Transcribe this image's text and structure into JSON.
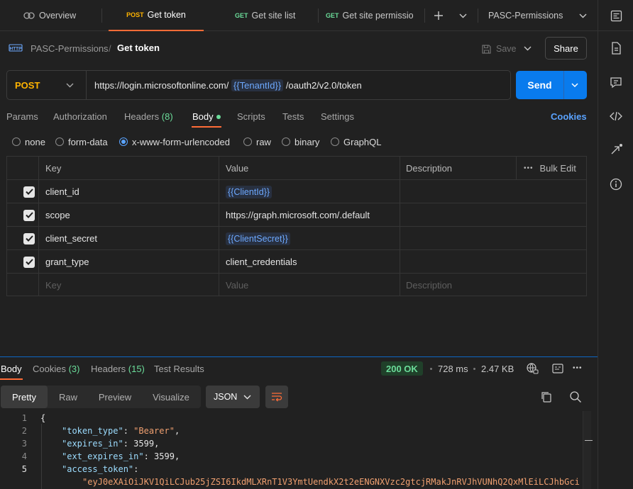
{
  "tabs": [
    {
      "method": "",
      "label": "Overview",
      "active": false
    },
    {
      "method": "POST",
      "label": "Get token",
      "active": true
    },
    {
      "method": "GET",
      "label": "Get site list",
      "active": false
    },
    {
      "method": "GET",
      "label": "Get site permission",
      "active": false
    }
  ],
  "workspace": {
    "env_label": "PASC-Permissions"
  },
  "breadcrumb": {
    "collection": "PASC-Permissions",
    "separator": "/",
    "request": "Get token"
  },
  "toolbar": {
    "save_label": "Save",
    "share_label": "Share"
  },
  "request": {
    "method": "POST",
    "url_prefix": "https://login.microsoftonline.com/",
    "url_var": "{{TenantId}}",
    "url_suffix": "/oauth2/v2.0/token",
    "send_label": "Send"
  },
  "request_tabs": {
    "params": "Params",
    "authorization": "Authorization",
    "headers": "Headers",
    "headers_count": "(8)",
    "body": "Body",
    "scripts": "Scripts",
    "tests": "Tests",
    "settings": "Settings",
    "cookies": "Cookies"
  },
  "body_types": [
    "none",
    "form-data",
    "x-www-form-urlencoded",
    "raw",
    "binary",
    "GraphQL"
  ],
  "body_type_selected": "x-www-form-urlencoded",
  "params_table": {
    "headers": {
      "key": "Key",
      "value": "Value",
      "description": "Description",
      "bulk_edit": "Bulk Edit"
    },
    "rows": [
      {
        "checked": true,
        "key": "client_id",
        "value": "{{ClientId}}",
        "is_var": true
      },
      {
        "checked": true,
        "key": "scope",
        "value": "https://graph.microsoft.com/.default",
        "is_var": false
      },
      {
        "checked": true,
        "key": "client_secret",
        "value": "{{ClientSecret}}",
        "is_var": true
      },
      {
        "checked": true,
        "key": "grant_type",
        "value": "client_credentials",
        "is_var": false
      }
    ],
    "placeholders": {
      "key": "Key",
      "value": "Value",
      "description": "Description"
    }
  },
  "response": {
    "tabs": {
      "body": "Body",
      "cookies": "Cookies",
      "cookies_count": "(3)",
      "headers": "Headers",
      "headers_count": "(15)",
      "test_results": "Test Results"
    },
    "status": "200 OK",
    "time": "728 ms",
    "size": "2.47 KB",
    "formats": [
      "Pretty",
      "Raw",
      "Preview",
      "Visualize"
    ],
    "language": "JSON",
    "lines": [
      {
        "n": "1",
        "text": "{"
      },
      {
        "n": "2",
        "key": "\"token_type\"",
        "val": "\"Bearer\"",
        "tail": ","
      },
      {
        "n": "3",
        "key": "\"expires_in\"",
        "num": "3599",
        "tail": ","
      },
      {
        "n": "4",
        "key": "\"ext_expires_in\"",
        "num": "3599",
        "tail": ","
      },
      {
        "n": "5",
        "key": "\"access_token\"",
        "tail": ":"
      },
      {
        "n": "",
        "val": "\"eyJ0eXAiOiJKV1QiLCJub25jZSI6IkdMLXRnT1V3YmtUendkX2t2eENGNXVzc2gtcjRMakJnRVJhVUNhQ2QxMlEiLCJhbGci"
      }
    ]
  },
  "colors": {
    "accent": "#ff6c37",
    "send": "#097bed",
    "post": "#ffb400",
    "get": "#6bdd9a",
    "link": "#5aa3ff"
  },
  "icons": [
    "http-icon",
    "save-icon",
    "overview-icon",
    "plus-icon",
    "chevron-down-icon",
    "environment-quick-look-icon",
    "documentation-icon",
    "comments-icon",
    "code-icon",
    "related-icon",
    "info-icon",
    "globe-lock-icon",
    "save-response-icon",
    "more-icon",
    "copy-icon",
    "search-icon",
    "wrap-lines-icon"
  ]
}
